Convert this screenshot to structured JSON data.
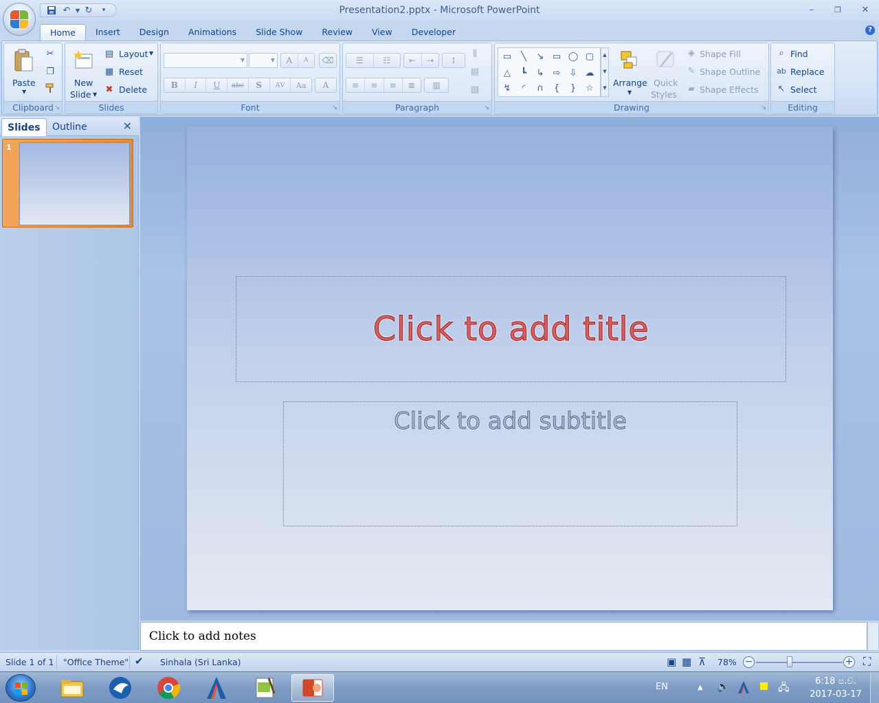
{
  "window": {
    "title": "Presentation2.pptx - Microsoft PowerPoint",
    "minimize": "–",
    "restore": "❐",
    "close": "✕"
  },
  "tabs": [
    "Home",
    "Insert",
    "Design",
    "Animations",
    "Slide Show",
    "Review",
    "View",
    "Developer"
  ],
  "ribbon": {
    "clipboard": {
      "label": "Clipboard",
      "paste": "Paste"
    },
    "slides": {
      "label": "Slides",
      "new_slide_1": "New",
      "new_slide_2": "Slide",
      "layout": "Layout",
      "reset": "Reset",
      "delete": "Delete"
    },
    "font": {
      "label": "Font",
      "bold": "B",
      "italic": "I",
      "underline": "U",
      "strike": "abc",
      "shadow": "S",
      "spacing": "AV",
      "case": "Aa",
      "color": "A",
      "grow": "A",
      "shrink": "A"
    },
    "paragraph": {
      "label": "Paragraph"
    },
    "drawing": {
      "label": "Drawing",
      "arrange": "Arrange",
      "quick_styles_1": "Quick",
      "quick_styles_2": "Styles",
      "shape_fill": "Shape Fill",
      "shape_outline": "Shape Outline",
      "shape_effects": "Shape Effects"
    },
    "editing": {
      "label": "Editing",
      "find": "Find",
      "replace": "Replace",
      "select": "Select"
    }
  },
  "left_pane": {
    "tabs": [
      "Slides",
      "Outline"
    ],
    "slide_number": "1"
  },
  "slide": {
    "title_placeholder": "Click to add title",
    "subtitle_placeholder": "Click to add subtitle"
  },
  "notes": {
    "placeholder": "Click to add notes"
  },
  "status_bar": {
    "slide_info": "Slide 1 of 1",
    "theme": "\"Office Theme\"",
    "language": "Sinhala (Sri Lanka)",
    "zoom": "78%",
    "zoom_level_fraction": 0.39
  },
  "taskbar": {
    "language": "EN",
    "time": "6:18 ප.ව.",
    "date": "2017-03-17"
  },
  "colors": {
    "title_text": "#e35b5b",
    "accent": "#15428b",
    "thumbnail_selected": "#e88a35"
  }
}
